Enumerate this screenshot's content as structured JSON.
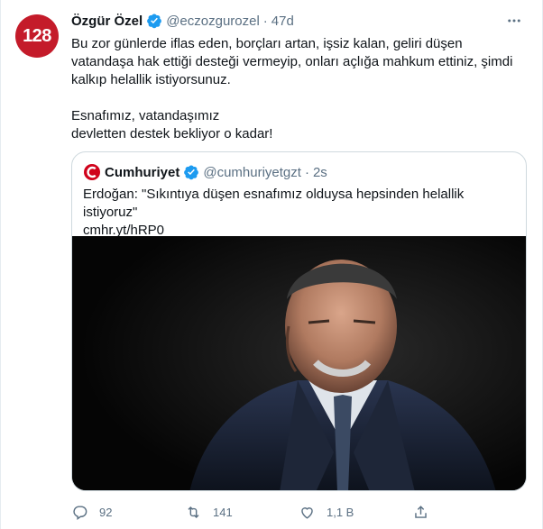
{
  "tweet": {
    "avatar_text": "128",
    "author_name": "Özgür Özel",
    "handle": "@eczozgurozel",
    "separator": "·",
    "time": "47d",
    "paragraphs": [
      "Bu zor günlerde iflas eden, borçları artan, işsiz kalan, geliri düşen vatandaşa hak ettiği desteği vermeyip, onları açlığa mahkum ettiniz, şimdi kalkıp helallik istiyorsunuz.",
      "Esnafımız, vatandaşımız\ndevletten destek bekliyor o kadar!"
    ]
  },
  "quote": {
    "author_name": "Cumhuriyet",
    "handle": "@cumhuriyetgzt",
    "separator": "·",
    "time": "2s",
    "text": "Erdoğan: \"Sıkıntıya düşen esnafımız olduysa hepsinden helallik istiyoruz\"",
    "link": "cmhr.yt/hRP0"
  },
  "actions": {
    "reply_count": "92",
    "retweet_count": "141",
    "like_count": "1,1 B"
  },
  "icons": {
    "verified": "verified-badge-icon",
    "more": "more-options-icon",
    "reply": "reply-icon",
    "retweet": "retweet-icon",
    "like": "heart-icon",
    "share": "share-icon"
  },
  "colors": {
    "accent": "#1d9bf0",
    "avatar_bg": "#c41b2a",
    "secondary_text": "#5b7083",
    "border": "#cfd9de"
  }
}
